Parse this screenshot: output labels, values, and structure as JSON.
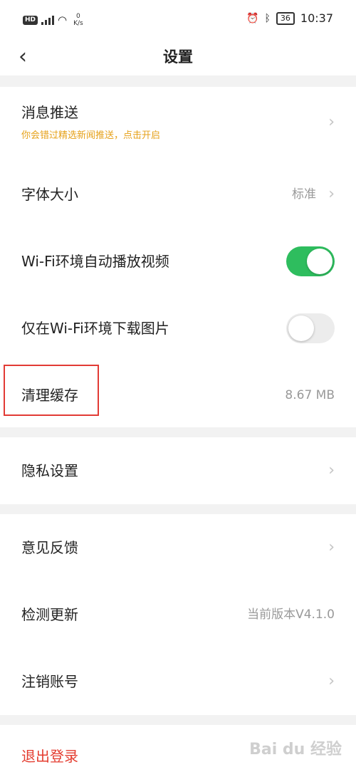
{
  "status_bar": {
    "hd": "HD",
    "net_speed_value": "0",
    "net_speed_unit": "K/s",
    "battery": "36",
    "time": "10:37"
  },
  "nav": {
    "title": "设置"
  },
  "settings": {
    "push": {
      "label": "消息推送",
      "hint": "你会错过精选新闻推送，点击开启"
    },
    "font_size": {
      "label": "字体大小",
      "value": "标准"
    },
    "wifi_autoplay": {
      "label": "Wi-Fi环境自动播放视频",
      "enabled": true
    },
    "wifi_download": {
      "label": "仅在Wi-Fi环境下载图片",
      "enabled": false
    },
    "clear_cache": {
      "label": "清理缓存",
      "value": "8.67 MB"
    },
    "privacy": {
      "label": "隐私设置"
    },
    "feedback": {
      "label": "意见反馈"
    },
    "update": {
      "label": "检测更新",
      "value": "当前版本V4.1.0"
    },
    "deactivate": {
      "label": "注销账号"
    },
    "logout": {
      "label": "退出登录"
    }
  },
  "colors": {
    "toggle_on": "#2ebd5e",
    "logout": "#e43c2f",
    "hint": "#e6a21b",
    "highlight_box": "#e23b35"
  },
  "watermark": "Bai du 经验"
}
